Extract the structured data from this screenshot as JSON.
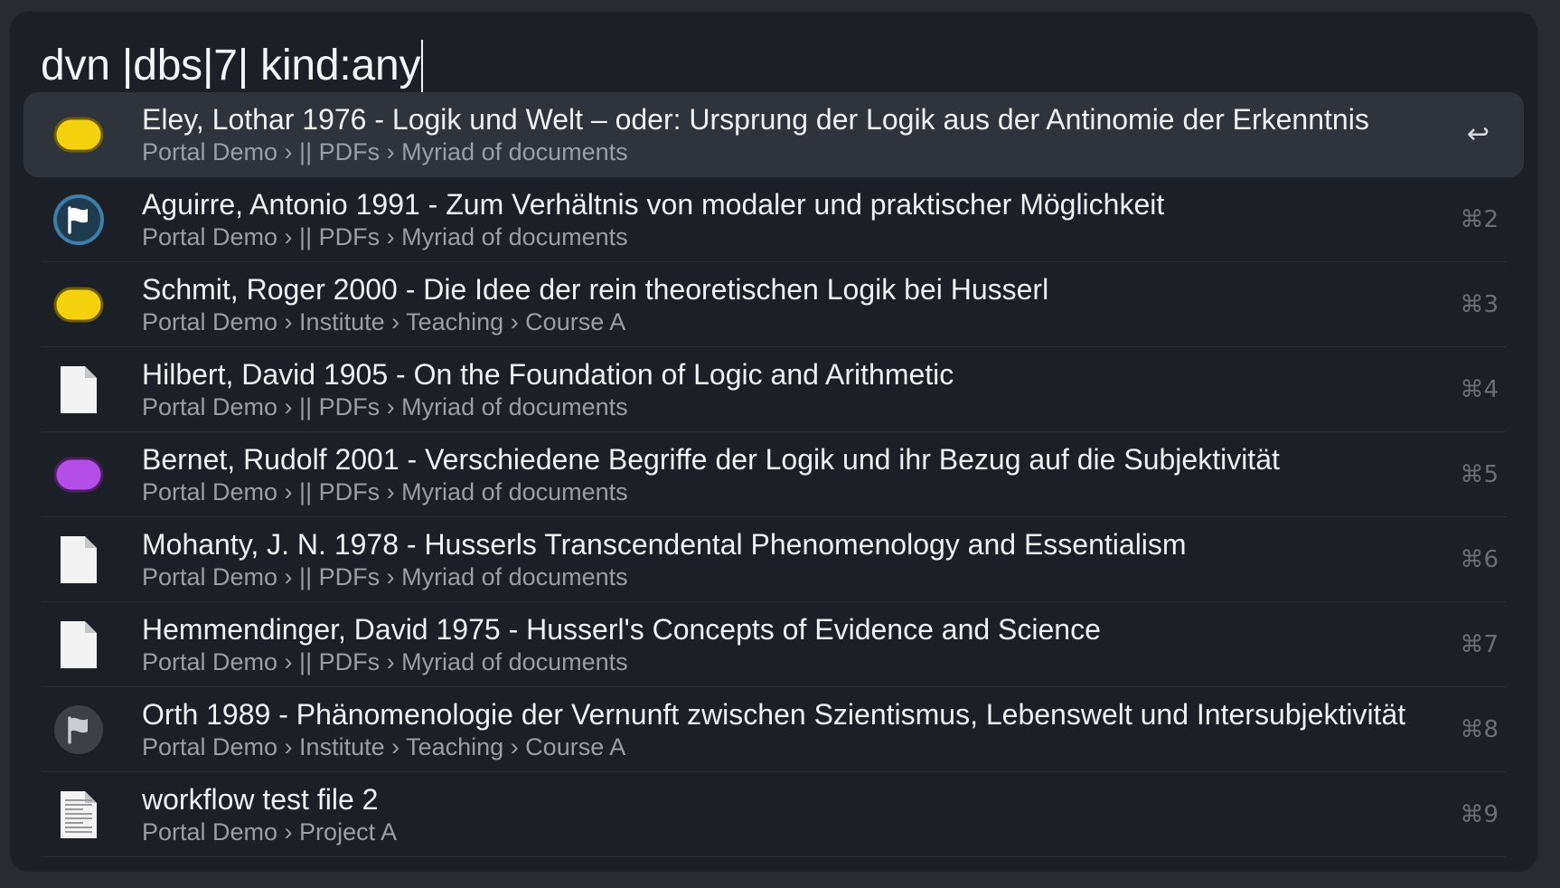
{
  "search": {
    "query": "dvn |dbs|7| kind:any"
  },
  "colors": {
    "window_bg": "#1c1f25",
    "selected_row_bg": "#2f333c",
    "title_text": "#f0f1f3",
    "path_text": "#9a9ea7",
    "shortcut_text": "#6a6e76",
    "tag_yellow": "#f5d20f",
    "tag_purple": "#b34ee6",
    "flag_blue": "#2f8fd1"
  },
  "results": [
    {
      "title": "Eley, Lothar 1976 - Logik und Welt – oder: Ursprung der Logik aus der Antinomie der Erkenntnis",
      "path": "Portal Demo › || PDFs › Myriad of documents",
      "icon": "yellow-tag-icon",
      "shortcut": "↩",
      "selected": true
    },
    {
      "title": "Aguirre, Antonio 1991 - Zum Verhältnis von modaler und praktischer Möglichkeit",
      "path": "Portal Demo › || PDFs › Myriad of documents",
      "icon": "blue-flag-icon",
      "shortcut": "⌘2"
    },
    {
      "title": "Schmit, Roger 2000 - Die Idee der rein theoretischen Logik bei Husserl",
      "path": "Portal Demo › Institute › Teaching › Course A",
      "icon": "yellow-tag-icon",
      "shortcut": "⌘3"
    },
    {
      "title": "Hilbert, David 1905 - On the Foundation of Logic and Arithmetic",
      "path": "Portal Demo › || PDFs › Myriad of documents",
      "icon": "document-icon",
      "shortcut": "⌘4"
    },
    {
      "title": "Bernet, Rudolf 2001 - Verschiedene Begriffe der Logik und ihr Bezug auf die Subjektivität",
      "path": "Portal Demo › || PDFs › Myriad of documents",
      "icon": "purple-tag-icon",
      "shortcut": "⌘5"
    },
    {
      "title": "Mohanty, J. N. 1978 - Husserls Transcendental Phenomenology and Essentialism",
      "path": "Portal Demo › || PDFs › Myriad of documents",
      "icon": "document-icon",
      "shortcut": "⌘6"
    },
    {
      "title": "Hemmendinger, David 1975 - Husserl's Concepts of Evidence and Science",
      "path": "Portal Demo › || PDFs › Myriad of documents",
      "icon": "document-icon",
      "shortcut": "⌘7"
    },
    {
      "title": "Orth 1989 - Phänomenologie der Vernunft zwischen Szientismus, Lebenswelt und Intersubjektivität",
      "path": "Portal Demo › Institute › Teaching › Course A",
      "icon": "gray-flag-icon",
      "shortcut": "⌘8"
    },
    {
      "title": "workflow test file 2",
      "path": "Portal Demo › Project A",
      "icon": "text-document-icon",
      "shortcut": "⌘9"
    }
  ]
}
